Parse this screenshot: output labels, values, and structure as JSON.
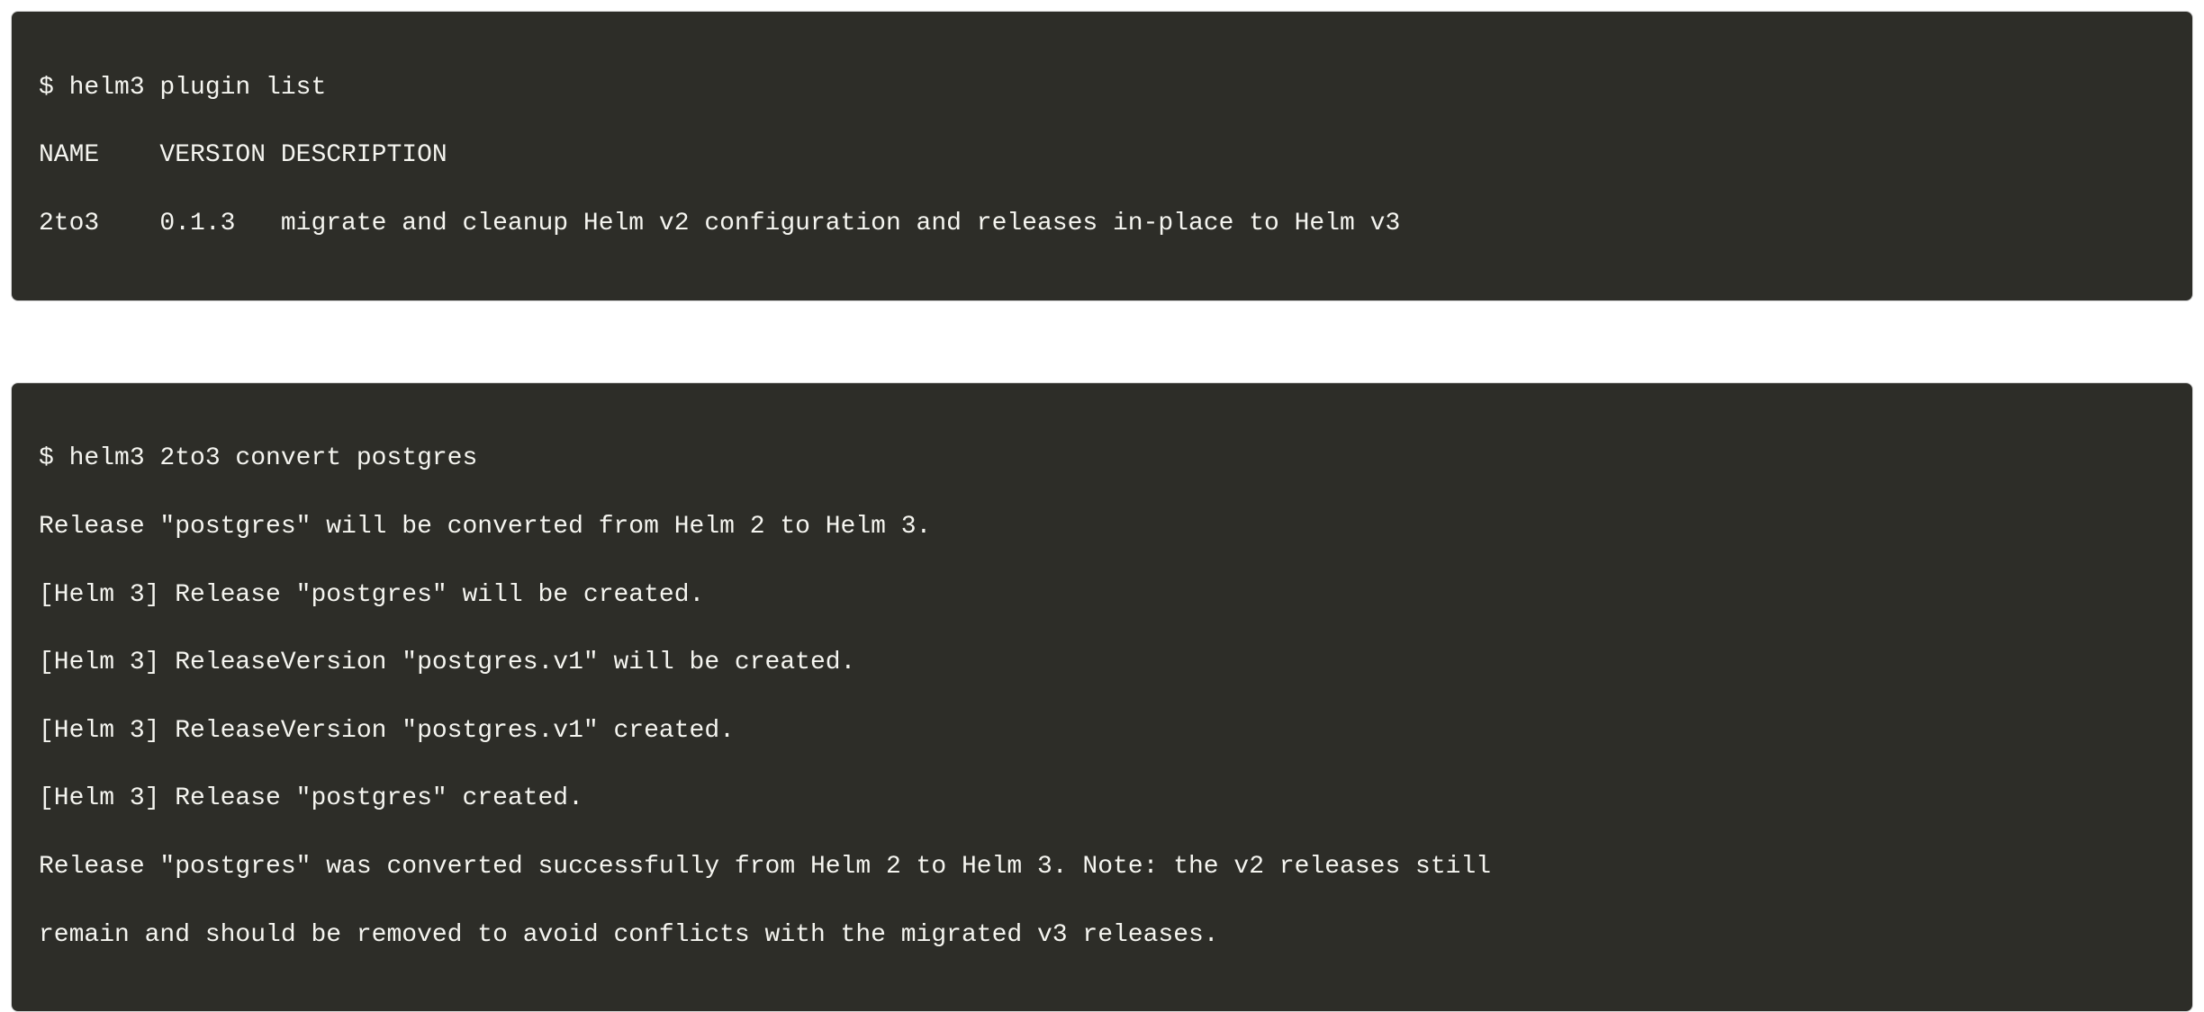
{
  "block1": {
    "line0": "$ helm3 plugin list",
    "line1": "NAME    VERSION DESCRIPTION",
    "line2": "2to3    0.1.3   migrate and cleanup Helm v2 configuration and releases in-place to Helm v3"
  },
  "block2": {
    "line0": "$ helm3 2to3 convert postgres",
    "line1": "Release \"postgres\" will be converted from Helm 2 to Helm 3.",
    "line2": "[Helm 3] Release \"postgres\" will be created.",
    "line3": "[Helm 3] ReleaseVersion \"postgres.v1\" will be created.",
    "line4": "[Helm 3] ReleaseVersion \"postgres.v1\" created.",
    "line5": "[Helm 3] Release \"postgres\" created.",
    "line6": "Release \"postgres\" was converted successfully from Helm 2 to Helm 3. Note: the v2 releases still",
    "line7": "remain and should be removed to avoid conflicts with the migrated v3 releases."
  }
}
